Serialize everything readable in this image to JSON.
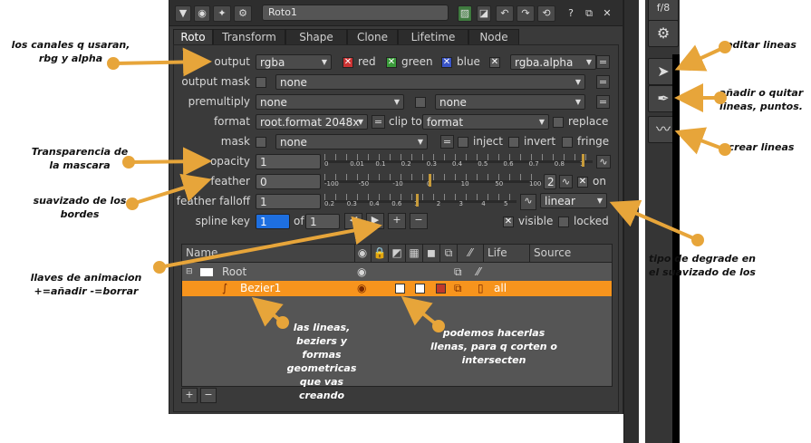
{
  "window": {
    "node_name": "Roto1",
    "help_label": "?"
  },
  "tabs": [
    "Roto",
    "Transform",
    "Shape",
    "Clone",
    "Lifetime",
    "Node"
  ],
  "params": {
    "output_label": "output",
    "output_value": "rgba",
    "channels": [
      "red",
      "green",
      "blue"
    ],
    "alpha_value": "rgba.alpha",
    "output_mask_label": "output mask",
    "output_mask_value": "none",
    "premultiply_label": "premultiply",
    "premultiply_value": "none",
    "premultiply_value2": "none",
    "format_label": "format",
    "format_value": "root.format 2048x",
    "clip_to_label": "clip to",
    "clip_to_value": "format",
    "replace_label": "replace",
    "mask_label": "mask",
    "mask_value": "none",
    "inject_label": "inject",
    "invert_label": "invert",
    "fringe_label": "fringe",
    "opacity_label": "opacity",
    "opacity_value": "1",
    "feather_label": "feather",
    "feather_value": "0",
    "feather_step": "2",
    "on_label": "on",
    "feather_falloff_label": "feather falloff",
    "feather_falloff_value": "1",
    "falloff_type": "linear",
    "spline_key_label": "spline key",
    "spline_key_value": "1",
    "of_label": "of",
    "spline_key_total": "1",
    "visible_label": "visible",
    "locked_label": "locked",
    "equals": "="
  },
  "sliders": {
    "opacity_ticks": [
      "0",
      "0.01",
      "0.1",
      "0.2",
      "0.3",
      "0.4",
      "0.5",
      "0.6",
      "0.7",
      "0.8",
      "1"
    ],
    "feather_ticks": [
      "-100",
      "-50",
      "-10",
      "0",
      "10",
      "50",
      "100"
    ],
    "falloff_ticks": [
      "0.2",
      "0.3",
      "0.4",
      "0.6",
      "1",
      "2",
      "3",
      "4",
      "5"
    ],
    "opacity": 1,
    "feather": 0,
    "feather_falloff": 1
  },
  "table": {
    "columns": [
      "Name",
      "Life",
      "Source"
    ],
    "rows": [
      {
        "name": "Root",
        "life": ""
      },
      {
        "name": "Bezier1",
        "life": "all"
      }
    ]
  },
  "bottom_buttons": [
    "+",
    "−"
  ],
  "right_toolbar": {
    "top_label": "f/8"
  },
  "annotations": {
    "channels": "los canales q usaran, rbg y alpha",
    "transparency": "Transparencia de la mascara",
    "feather": "suavizado de los bordes",
    "keys": "llaves de animacion +=añadir -=borrar",
    "lines": "las lineas, beziers y formas geometricas que vas creando",
    "fill": "podemos hacerlas llenas, para q corten o intersecten",
    "falloff": "tipo de degrade en el suavizado de los",
    "edit": "editar lineas",
    "add_remove": "añadir o quitar lineas, puntos.",
    "create": "crear lineas"
  },
  "colors": {
    "accent": "#f7941d",
    "arrow": "#e7a53a",
    "selection": "#f7941d",
    "spin_blue": "#1e6fe0"
  }
}
